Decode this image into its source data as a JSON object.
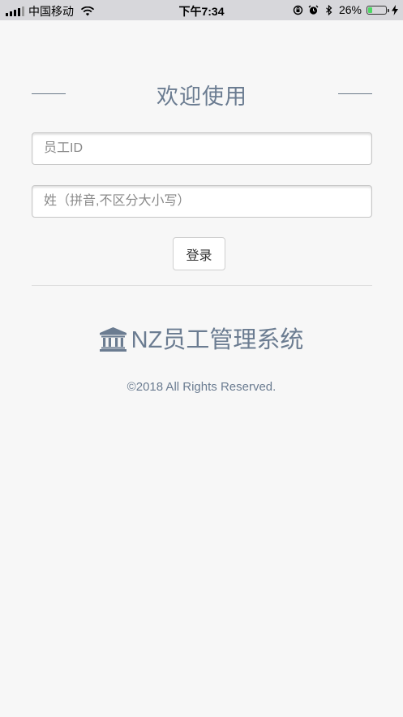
{
  "status_bar": {
    "carrier": "中国移动",
    "time": "下午7:34",
    "battery_percent": "26%",
    "battery_level": 0.26,
    "icons": [
      "signal-icon",
      "wifi-icon",
      "orientation-lock-icon",
      "alarm-icon",
      "bluetooth-icon",
      "battery-icon",
      "charging-icon"
    ]
  },
  "login": {
    "title": "欢迎使用",
    "employee_id": {
      "placeholder": "员工ID",
      "value": ""
    },
    "surname": {
      "placeholder": "姓（拼音,不区分大小写）",
      "value": ""
    },
    "login_button": "登录"
  },
  "brand": {
    "icon": "bank-icon",
    "name": "NZ员工管理系统"
  },
  "footer": {
    "copyright": "©2018 All Rights Reserved."
  },
  "colors": {
    "accent": "#6b7c91",
    "background": "#f7f7f7",
    "status_bar": "#d7d7db",
    "battery_fill": "#4cd964"
  }
}
